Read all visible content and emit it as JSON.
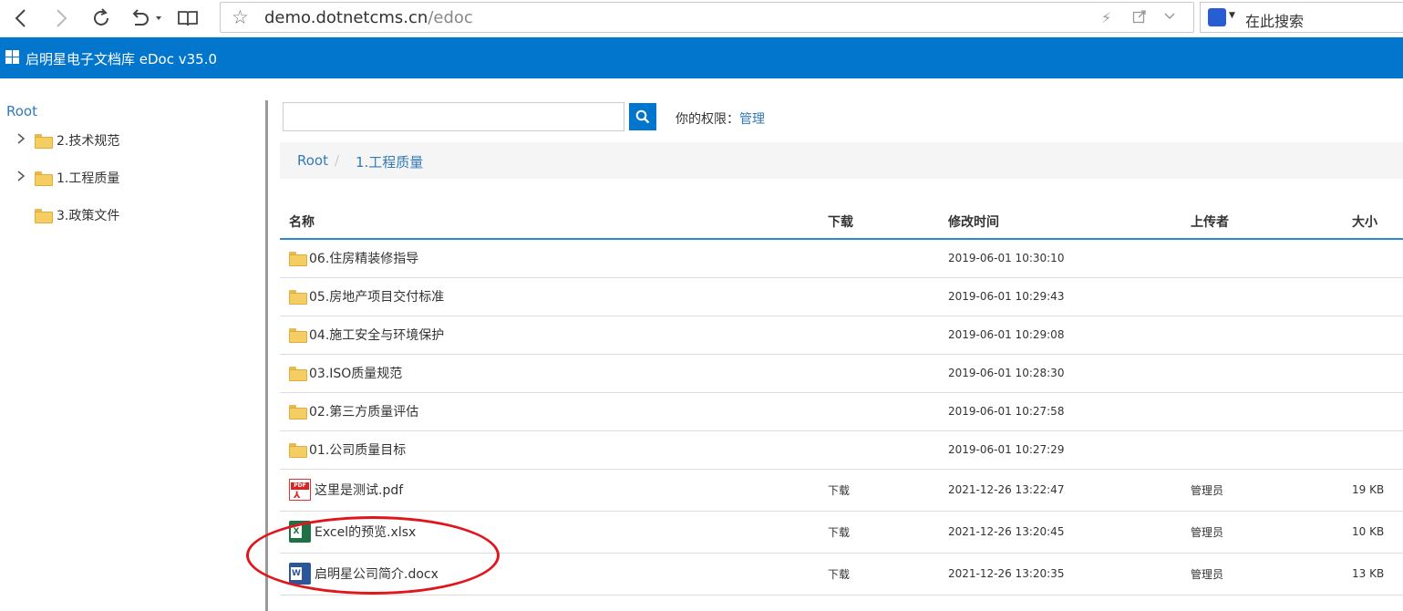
{
  "browser": {
    "url_host": "demo.dotnetcms.cn",
    "url_path": "/edoc",
    "search_placeholder": "在此搜索"
  },
  "app": {
    "title": "启明星电子文档库 eDoc v35.0"
  },
  "sidebar": {
    "root": "Root",
    "items": [
      {
        "label": "2.技术规范"
      },
      {
        "label": "1.工程质量"
      },
      {
        "label": "3.政策文件"
      }
    ]
  },
  "main": {
    "permission_label": "你的权限：",
    "permission_value": "管理",
    "breadcrumb": [
      "Root",
      "/",
      "1.工程质量"
    ],
    "columns": [
      "名称",
      "下载",
      "修改时间",
      "上传者",
      "大小"
    ],
    "rows": [
      {
        "name": "06.住房精装修指导",
        "download": "",
        "time": "2019-06-01 10:30:10",
        "uploader": "",
        "size": ""
      },
      {
        "name": "05.房地产项目交付标准",
        "download": "",
        "time": "2019-06-01 10:29:43",
        "uploader": "",
        "size": ""
      },
      {
        "name": "04.施工安全与环境保护",
        "download": "",
        "time": "2019-06-01 10:29:08",
        "uploader": "",
        "size": ""
      },
      {
        "name": "03.ISO质量规范",
        "download": "",
        "time": "2019-06-01 10:28:30",
        "uploader": "",
        "size": ""
      },
      {
        "name": "02.第三方质量评估",
        "download": "",
        "time": "2019-06-01 10:27:58",
        "uploader": "",
        "size": ""
      },
      {
        "name": "01.公司质量目标",
        "download": "",
        "time": "2019-06-01 10:27:29",
        "uploader": "",
        "size": ""
      },
      {
        "name": "这里是测试.pdf",
        "download": "下载",
        "time": "2021-12-26 13:22:47",
        "uploader": "管理员",
        "size": "19 KB"
      },
      {
        "name": "Excel的预览.xlsx",
        "download": "下载",
        "time": "2021-12-26 13:20:45",
        "uploader": "管理员",
        "size": "10 KB"
      },
      {
        "name": "启明星公司简介.docx",
        "download": "下载",
        "time": "2021-12-26 13:20:35",
        "uploader": "管理员",
        "size": "13 KB"
      }
    ]
  },
  "icons": {
    "pdf_badge": "PDF",
    "xls_badge": "X",
    "doc_badge": "W",
    "annotation_color": "#e0161c",
    "accent": "#0276cd"
  }
}
